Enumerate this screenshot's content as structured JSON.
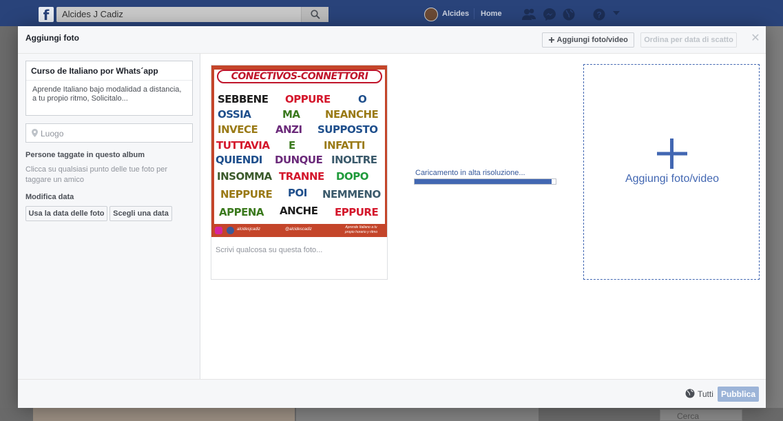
{
  "facebook_bar": {
    "search_value": "Alcides J Cadiz",
    "user_name": "Alcides",
    "home_label": "Home"
  },
  "background": {
    "search_placeholder": "Cerca"
  },
  "dialog": {
    "title": "Aggiungi foto",
    "add_button_label": "Aggiungi foto/video",
    "sort_button_label": "Ordina per data di scatto",
    "album": {
      "name": "Curso de Italiano por Whats´app",
      "description": "Aprende Italiano bajo modalidad a distancia, a tu propio ritmo, Solicitalo..."
    },
    "location_placeholder": "Luogo",
    "tagged_title": "Persone taggate in questo album",
    "tagged_description": "Clicca su qualsiasi punto delle tue foto per taggare un amico",
    "date_title": "Modifica data",
    "date_buttons": [
      "Usa la data delle foto",
      "Scegli una data"
    ],
    "photo": {
      "heading": "CONECTIVOS-CONNETTORI",
      "words": [
        {
          "text": "SEBBENE",
          "color": "#1d1d1d"
        },
        {
          "text": "OPPURE",
          "color": "#d4172c"
        },
        {
          "text": "O",
          "color": "#1f4f8c"
        },
        {
          "text": "OSSIA",
          "color": "#1f4f8c"
        },
        {
          "text": "MA",
          "color": "#3b7a1e"
        },
        {
          "text": "NEANCHE",
          "color": "#9a7a16"
        },
        {
          "text": "INVECE",
          "color": "#9a7a16"
        },
        {
          "text": "ANZI",
          "color": "#6b2a7a"
        },
        {
          "text": "SUPPOSTO",
          "color": "#1f4f8c"
        },
        {
          "text": "TUTTAVIA",
          "color": "#d4172c"
        },
        {
          "text": "E",
          "color": "#3b7a1e"
        },
        {
          "text": "INFATTI",
          "color": "#9a7a16"
        },
        {
          "text": "QUIENDI",
          "color": "#1f4f8c"
        },
        {
          "text": "DUNQUE",
          "color": "#6b2a7a"
        },
        {
          "text": "INOLTRE",
          "color": "#3b5a6b"
        },
        {
          "text": "INSOMMA",
          "color": "#3b5a2b"
        },
        {
          "text": "TRANNE",
          "color": "#d4172c"
        },
        {
          "text": "DOPO",
          "color": "#1e9a3a"
        },
        {
          "text": "NEPPURE",
          "color": "#9a7a16"
        },
        {
          "text": "POI",
          "color": "#1f4f8c"
        },
        {
          "text": "NEMMENO",
          "color": "#3b5a6b"
        },
        {
          "text": "APPENA",
          "color": "#3b7a1e"
        },
        {
          "text": "ANCHE",
          "color": "#1d1d1d"
        },
        {
          "text": "EPPURE",
          "color": "#d4172c"
        }
      ],
      "footer_handle_fb": "alcidesjcadiz",
      "footer_handle_ig": "@alcidescadiz",
      "footer_slogan": "Aprende Italiano a tu propio horario y ritmo",
      "caption_placeholder": "Scrivi qualcosa su questa foto..."
    },
    "upload": {
      "label": "Caricamento in alta risoluzione...",
      "progress": 0.97
    },
    "add_tile_label": "Aggiungi foto/video",
    "privacy_label": "Tutti",
    "publish_label": "Pubblica"
  },
  "colors": {
    "facebook_blue": "#29437a",
    "accent_blue": "#4267b2",
    "publish_disabled": "#9cb4d8"
  }
}
